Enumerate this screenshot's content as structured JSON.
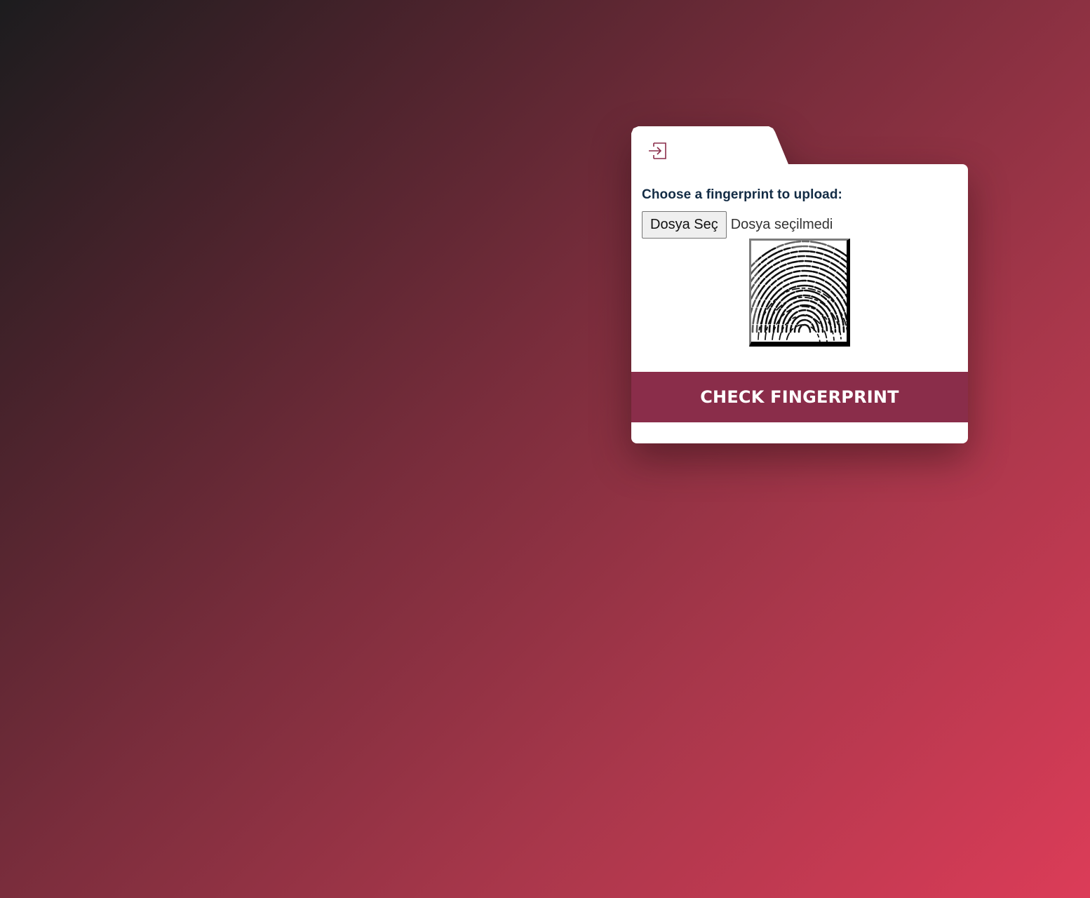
{
  "tab": {
    "icon": "login-icon"
  },
  "upload": {
    "label": "Choose a fingerprint to upload:",
    "button_label": "Dosya Seç",
    "status_text": "Dosya seçilmedi"
  },
  "preview": {
    "image": "fingerprint-image"
  },
  "actions": {
    "check_label": "CHECK FINGERPRINT"
  },
  "colors": {
    "accent": "#8a2d4a",
    "label_text": "#132c45",
    "gradient_start": "#1c1c1e",
    "gradient_end": "#dc3c58"
  }
}
